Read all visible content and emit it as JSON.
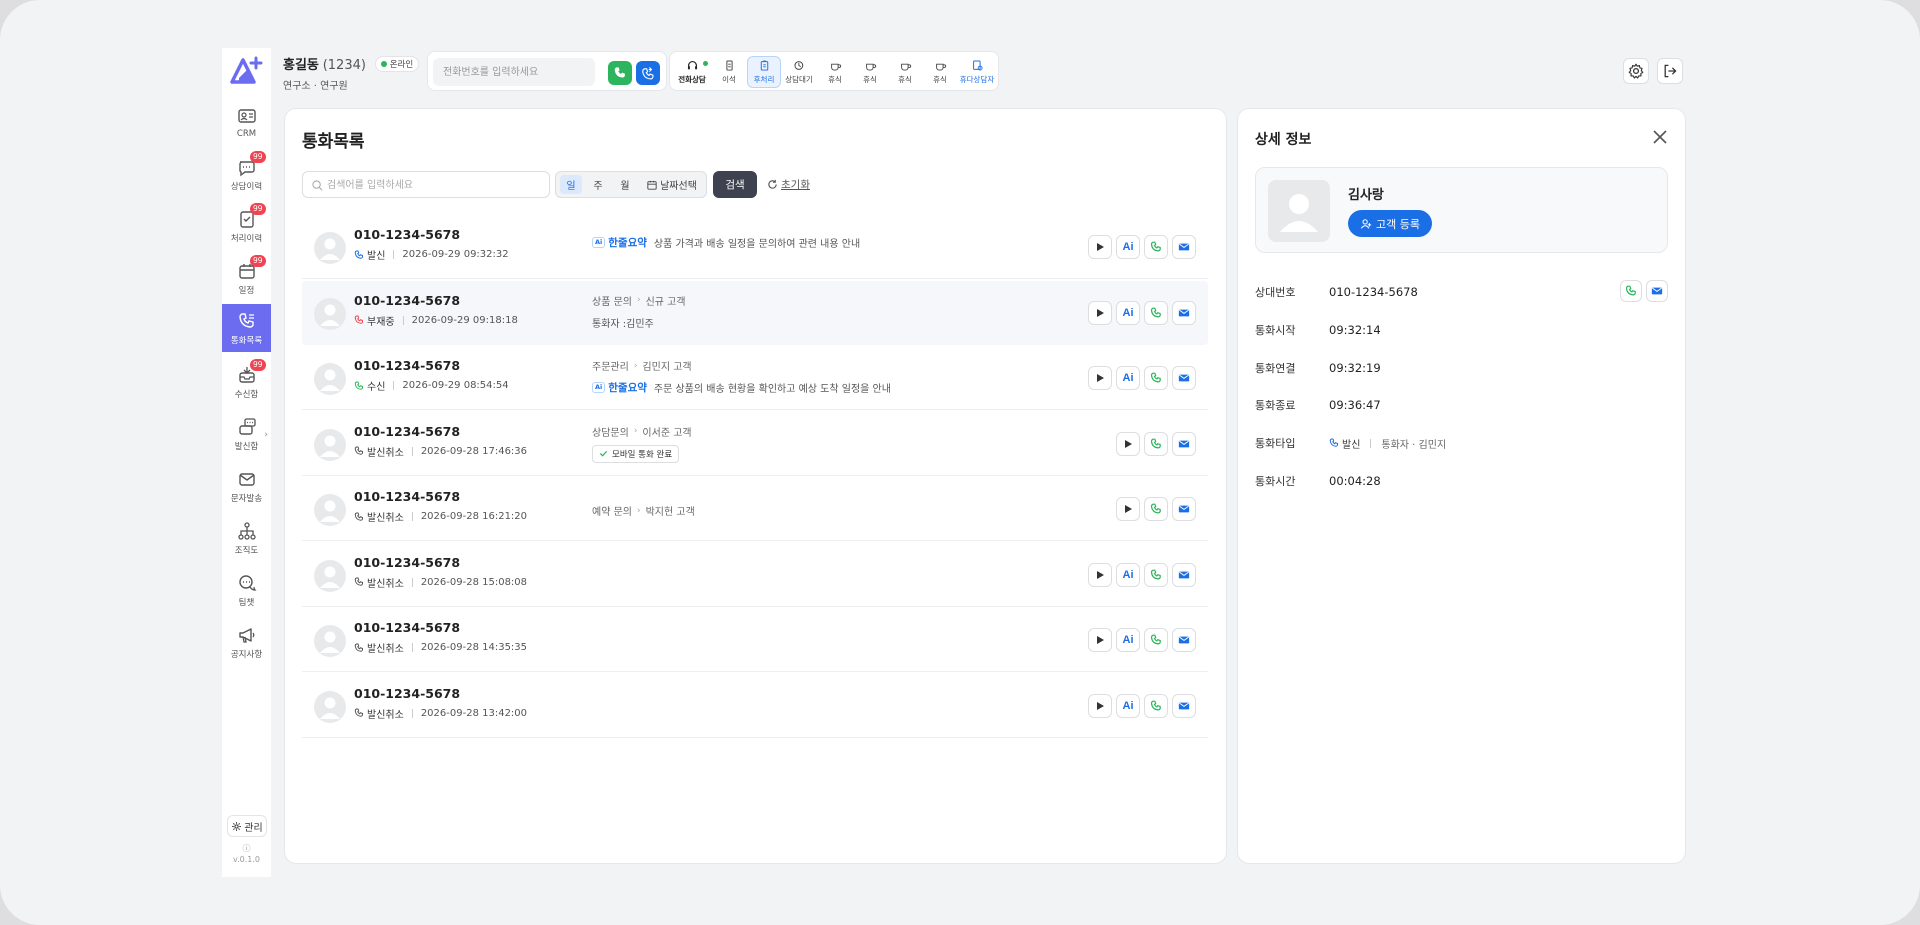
{
  "sidebar": {
    "items": [
      {
        "label": "CRM",
        "icon": "contact-card-icon",
        "badge": ""
      },
      {
        "label": "상담이력",
        "icon": "chat-history-icon",
        "badge": "99"
      },
      {
        "label": "처리이력",
        "icon": "task-history-icon",
        "badge": "99"
      },
      {
        "label": "일정",
        "icon": "calendar-icon",
        "badge": "99"
      },
      {
        "label": "통화목록",
        "icon": "call-list-icon",
        "badge": "",
        "active": true
      },
      {
        "label": "수신함",
        "icon": "inbox-icon",
        "badge": "99"
      },
      {
        "label": "발신함",
        "icon": "outbox-icon",
        "badge": ""
      },
      {
        "label": "문자발송",
        "icon": "mail-icon",
        "badge": ""
      },
      {
        "label": "조직도",
        "icon": "org-chart-icon",
        "badge": ""
      },
      {
        "label": "팀챗",
        "icon": "team-chat-icon",
        "badge": ""
      },
      {
        "label": "공지사항",
        "icon": "megaphone-icon",
        "badge": ""
      }
    ],
    "admin_label": "관리",
    "version": "v.0.1.0"
  },
  "header": {
    "user_name": "홍길동",
    "user_ext": "(1234)",
    "status": "온라인",
    "dept": "연구소 · 연구원",
    "phone_placeholder": "전화번호를 입력하세요",
    "statuses": [
      {
        "label": "전화상담"
      },
      {
        "label": "이석"
      },
      {
        "label": "후처리"
      },
      {
        "label": "상담대기"
      },
      {
        "label": "휴식"
      },
      {
        "label": "휴식"
      },
      {
        "label": "휴식"
      },
      {
        "label": "휴식"
      },
      {
        "label": "휴다상담자"
      }
    ]
  },
  "list": {
    "title": "통화목록",
    "search_placeholder": "검색어를 입력하세요",
    "period": [
      "일",
      "주",
      "월"
    ],
    "date_select": "날짜선택",
    "search_btn": "검색",
    "reset_btn": "초기화",
    "ai_box": "Ai",
    "ai_label": "한줄요약",
    "ai_btn": "Ai",
    "rows": [
      {
        "number": "010-1234-5678",
        "type": "발신",
        "type_color": "#1a6fe6",
        "time": "2026-09-29 09:32:32",
        "info1": [],
        "info2_ai": true,
        "info2": "상품 가격과 배송 일정을 문의하여 관련 내용 안내",
        "has_ai": true
      },
      {
        "number": "010-1234-5678",
        "type": "부재중",
        "type_color": "#f04452",
        "time": "2026-09-29 09:18:18",
        "info1": [
          "상품 문의",
          "신규 고객"
        ],
        "info2_ai": false,
        "info2": "통화자 :김민주",
        "has_ai": true
      },
      {
        "number": "010-1234-5678",
        "type": "수신",
        "type_color": "#2db55d",
        "time": "2026-09-29 08:54:54",
        "info1": [
          "주문관리",
          "김민지 고객"
        ],
        "info2_ai": true,
        "info2": "주문 상품의 배송 현황을 확인하고 예상 도착 일정을 안내",
        "has_ai": true
      },
      {
        "number": "010-1234-5678",
        "type": "발신취소",
        "type_color": "#555555",
        "time": "2026-09-28 17:46:36",
        "info1": [
          "상담문의",
          "이서준 고객"
        ],
        "info2_done": "모바일 통화 완료",
        "has_ai": false
      },
      {
        "number": "010-1234-5678",
        "type": "발신취소",
        "type_color": "#555555",
        "time": "2026-09-28 16:21:20",
        "info1": [
          "예약 문의",
          "박지헌 고객"
        ],
        "has_ai": false
      },
      {
        "number": "010-1234-5678",
        "type": "발신취소",
        "type_color": "#555555",
        "time": "2026-09-28 15:08:08",
        "info1": [],
        "has_ai": true
      },
      {
        "number": "010-1234-5678",
        "type": "발신취소",
        "type_color": "#555555",
        "time": "2026-09-28 14:35:35",
        "info1": [],
        "has_ai": true
      },
      {
        "number": "010-1234-5678",
        "type": "발신취소",
        "type_color": "#555555",
        "time": "2026-09-28 13:42:00",
        "info1": [],
        "has_ai": true
      }
    ]
  },
  "detail": {
    "title": "상세 정보",
    "customer_name": "김사랑",
    "register_btn": "고객 등록",
    "fields": [
      {
        "key": "상대번호",
        "value": "010-1234-5678"
      },
      {
        "key": "통화시작",
        "value": "09:32:14"
      },
      {
        "key": "통화연결",
        "value": "09:32:19"
      },
      {
        "key": "통화종료",
        "value": "09:36:47"
      },
      {
        "key": "통화타입",
        "value": ""
      },
      {
        "key": "통화시간",
        "value": "00:04:28"
      }
    ],
    "call_type": "발신",
    "call_party": "통화자 · 김민지"
  },
  "colors": {
    "accent": "#1a6fe6",
    "sidebar_active": "#6b6cf0",
    "green": "#2db55d",
    "red": "#f04452"
  }
}
